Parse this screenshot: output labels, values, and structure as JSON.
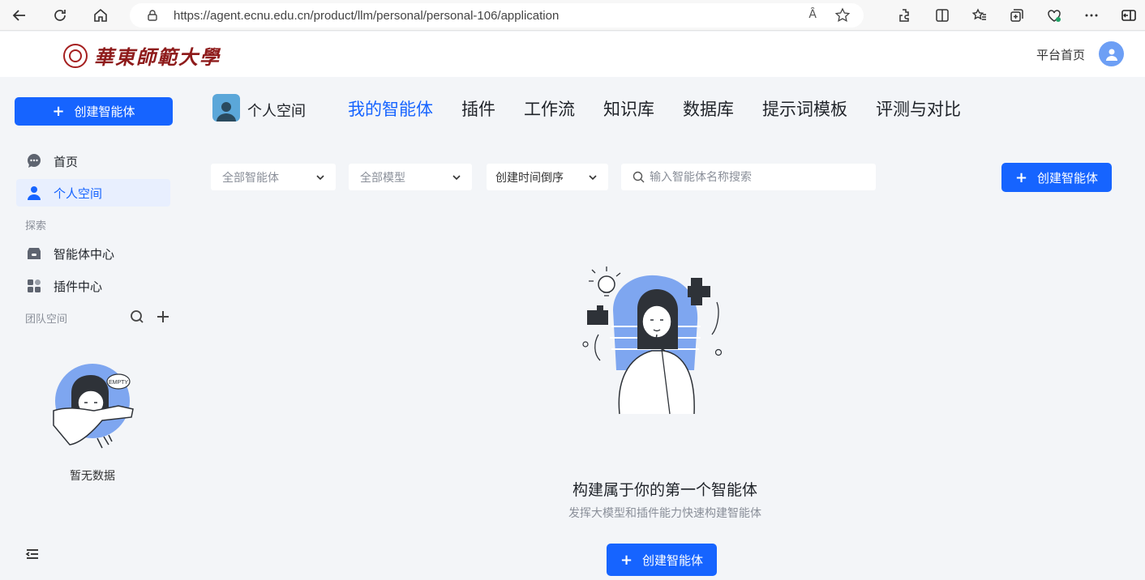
{
  "browser": {
    "url": "https://agent.ecnu.edu.cn/product/llm/personal/personal-106/application",
    "read_aloud": "Ȃ"
  },
  "header": {
    "logo_text": "華東師範大學",
    "home_link": "平台首页"
  },
  "sidebar": {
    "create_label": "创建智能体",
    "items": [
      {
        "label": "首页",
        "icon": "chat-bubble-icon"
      },
      {
        "label": "个人空间",
        "icon": "user-icon"
      }
    ],
    "explore_label": "探索",
    "explore_items": [
      {
        "label": "智能体中心",
        "icon": "agent-store-icon"
      },
      {
        "label": "插件中心",
        "icon": "plugin-grid-icon"
      }
    ],
    "team_label": "团队空间",
    "empty_text": "暂无数据",
    "empty_bubble": "EMPTY"
  },
  "main": {
    "space_title": "个人空间",
    "tabs": [
      {
        "label": "我的智能体",
        "active": true
      },
      {
        "label": "插件",
        "active": false
      },
      {
        "label": "工作流",
        "active": false
      },
      {
        "label": "知识库",
        "active": false
      },
      {
        "label": "数据库",
        "active": false
      },
      {
        "label": "提示词模板",
        "active": false
      },
      {
        "label": "评测与对比",
        "active": false
      }
    ],
    "filters": {
      "agent_type": "全部智能体",
      "model": "全部模型",
      "sort": "创建时间倒序"
    },
    "search_placeholder": "输入智能体名称搜索",
    "create_label": "创建智能体",
    "empty_title": "构建属于你的第一个智能体",
    "empty_subtitle": "发挥大模型和插件能力快速构建智能体",
    "empty_create_label": "创建智能体"
  },
  "colors": {
    "accent": "#1664ff",
    "brand": "#8e1b1b"
  }
}
